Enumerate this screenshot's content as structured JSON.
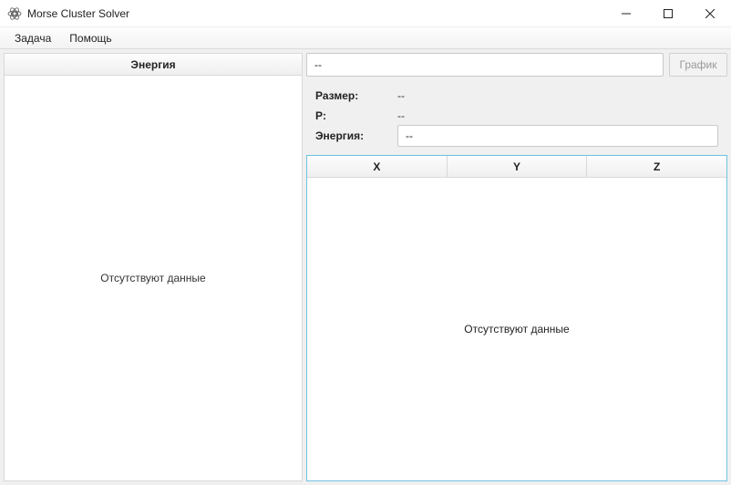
{
  "window": {
    "title": "Morse Cluster Solver"
  },
  "menu": {
    "task": "Задача",
    "help": "Помощь"
  },
  "left": {
    "header": "Энергия",
    "empty": "Отсутствуют данные"
  },
  "right": {
    "name_value": "--",
    "graph_btn": "График",
    "size_label": "Размер:",
    "size_value": "--",
    "p_label": "P:",
    "p_value": "--",
    "energy_label": "Энергия:",
    "energy_value": "--"
  },
  "table": {
    "col_x": "X",
    "col_y": "Y",
    "col_z": "Z",
    "empty": "Отсутствуют данные"
  }
}
